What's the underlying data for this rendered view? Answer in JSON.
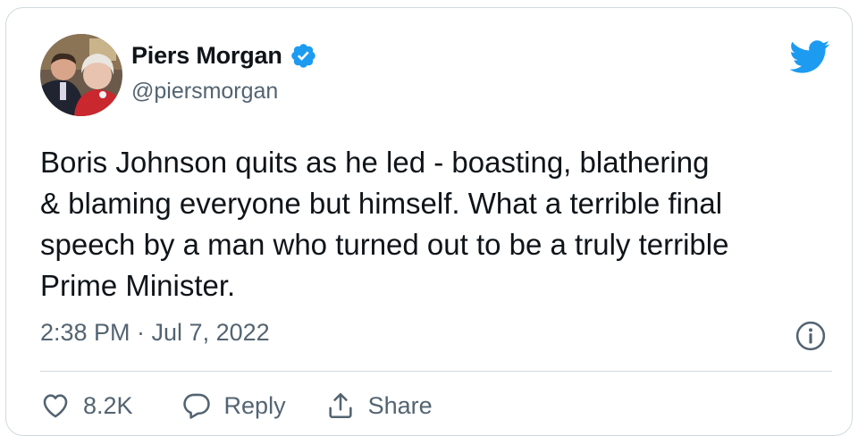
{
  "tweet": {
    "author": {
      "name": "Piers Morgan",
      "handle": "@piersmorgan",
      "avatar_icon": "profile-photo-avatar",
      "verified_icon": "verified-badge-icon"
    },
    "logo_icon": "twitter-bird-icon",
    "text": "Boris Johnson quits as he led - boasting, blathering\n& blaming everyone but himself. What a terrible final\nspeech by a man who turned out to be a truly terrible\nPrime Minister.",
    "timestamp": "2:38 PM · Jul 7, 2022",
    "info_icon": "info-icon",
    "actions": {
      "like_count": "8.2K",
      "reply_label": "Reply",
      "share_label": "Share"
    }
  },
  "colors": {
    "twitter_blue": "#1d9bf0",
    "text": "#0f1419",
    "secondary_text": "#536471",
    "border": "#cfd9de"
  }
}
